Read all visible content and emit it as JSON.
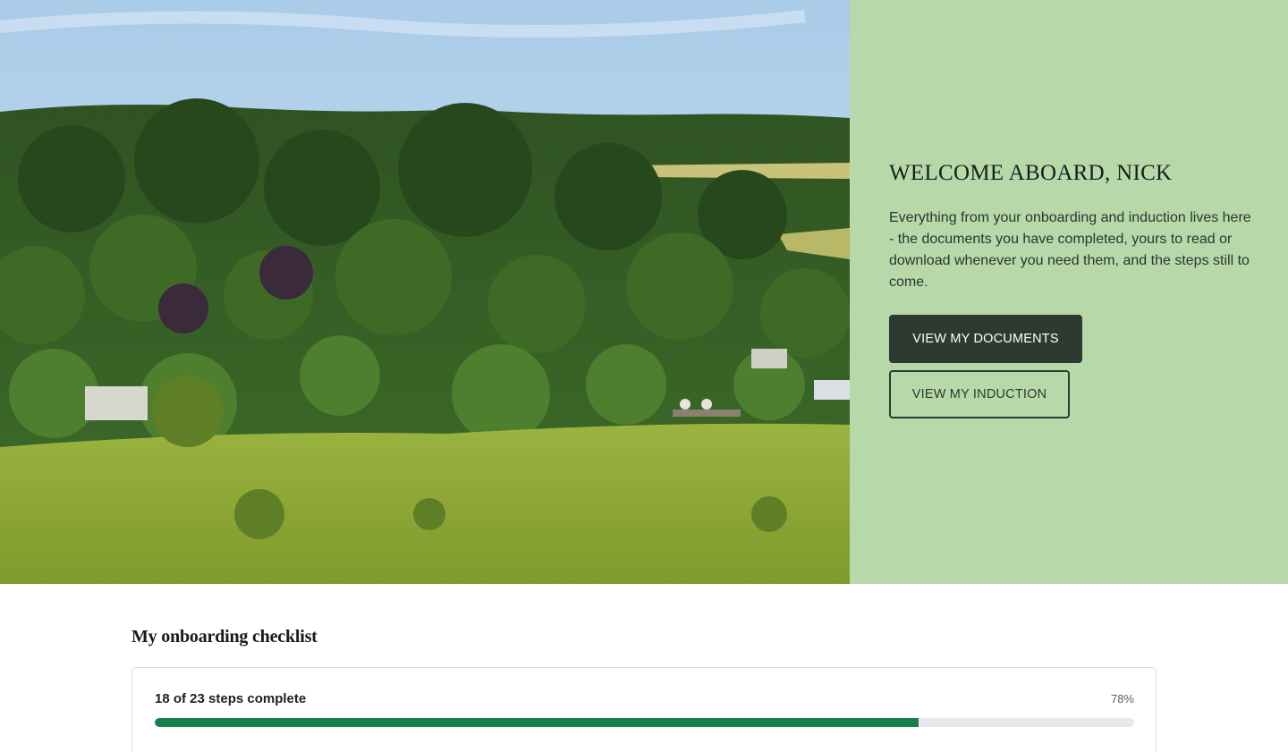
{
  "hero": {
    "photo_alt_icon": "landscape-photo",
    "welcome_title": "WELCOME ABOARD, NICK",
    "welcome_body": "Everything from your onboarding and induction lives here - the documents you have completed, yours to read or download whenever you need them, and the steps still to come.",
    "primary_button_label": "VIEW MY DOCUMENTS",
    "secondary_button_label": "VIEW MY INDUCTION"
  },
  "checklist": {
    "heading": "My onboarding checklist",
    "progress_label": "18 of 23 steps complete",
    "progress_percent_text": "78%",
    "progress_fraction": 0.78
  },
  "colors": {
    "panel_background": "#b7d9aa",
    "primary_button": "#2c3a31",
    "progress_fill": "#17804b",
    "progress_track": "#e7e9ec"
  }
}
